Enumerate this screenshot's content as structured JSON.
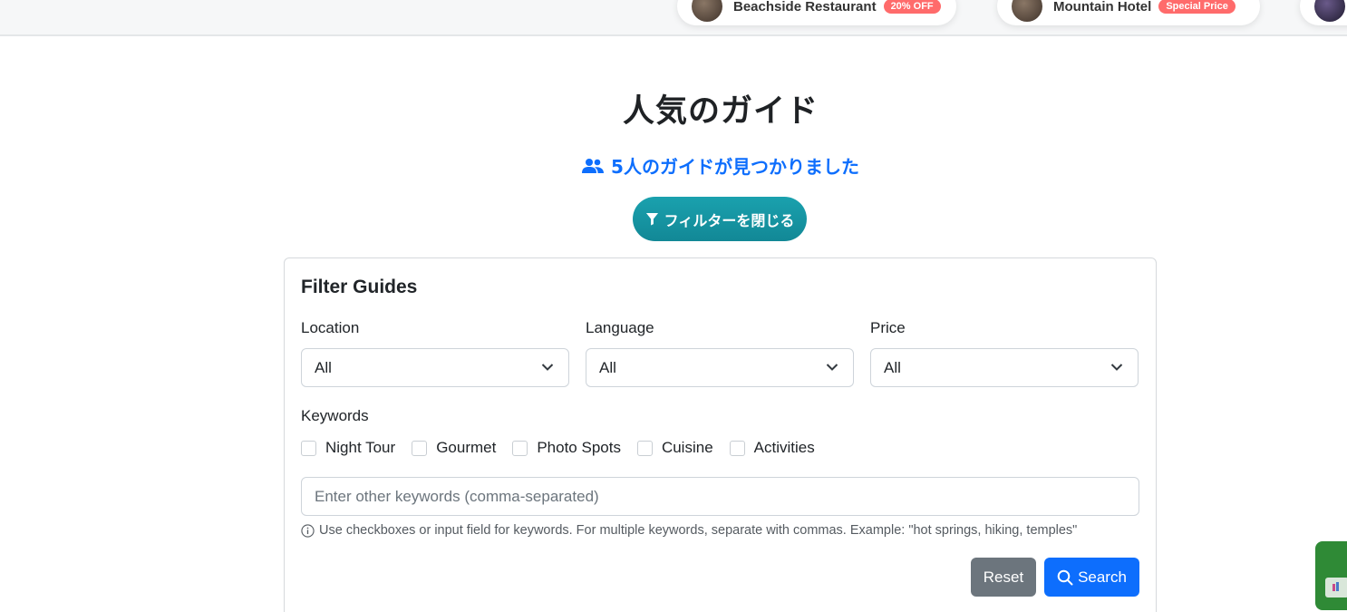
{
  "promos": [
    {
      "name": "Beachside Restaurant",
      "badge": "20% OFF"
    },
    {
      "name": "Mountain Hotel",
      "badge": "Special Price"
    },
    {
      "name": "",
      "badge": ""
    }
  ],
  "header": {
    "title": "人気のガイド",
    "found_text": "5人のガイドが見つかりました",
    "toggle_filter_label": "フィルターを閉じる"
  },
  "filter": {
    "title": "Filter Guides",
    "location": {
      "label": "Location",
      "value": "All"
    },
    "language": {
      "label": "Language",
      "value": "All"
    },
    "price": {
      "label": "Price",
      "value": "All"
    },
    "keywords_label": "Keywords",
    "checkboxes": [
      "Night Tour",
      "Gourmet",
      "Photo Spots",
      "Cuisine",
      "Activities"
    ],
    "keyword_input_placeholder": "Enter other keywords (comma-separated)",
    "hint": "Use checkboxes or input field for keywords. For multiple keywords, separate with commas. Example: \"hot springs, hiking, temples\"",
    "reset_label": "Reset",
    "search_label": "Search"
  },
  "colors": {
    "primary": "#0d6efd",
    "teal": "#17a2b8",
    "secondary": "#6c757d",
    "badge": "#ff6b6b",
    "widget_green": "#2f8a36"
  }
}
